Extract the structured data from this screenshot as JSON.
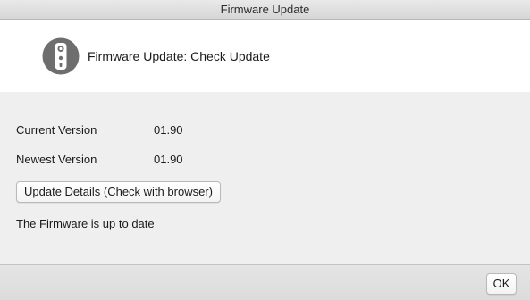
{
  "window": {
    "title": "Firmware Update"
  },
  "header": {
    "icon": "camera-device-icon",
    "title": "Firmware Update: Check Update"
  },
  "versions": {
    "current_label": "Current Version",
    "current_value": "01.90",
    "newest_label": "Newest Version",
    "newest_value": "01.90"
  },
  "details_button_label": "Update Details (Check with browser)",
  "status_text": "The Firmware is up to date",
  "footer": {
    "ok_label": "OK"
  },
  "colors": {
    "icon_circle": "#6e6e6e",
    "header_background": "#ffffff",
    "content_background": "#efefef"
  }
}
